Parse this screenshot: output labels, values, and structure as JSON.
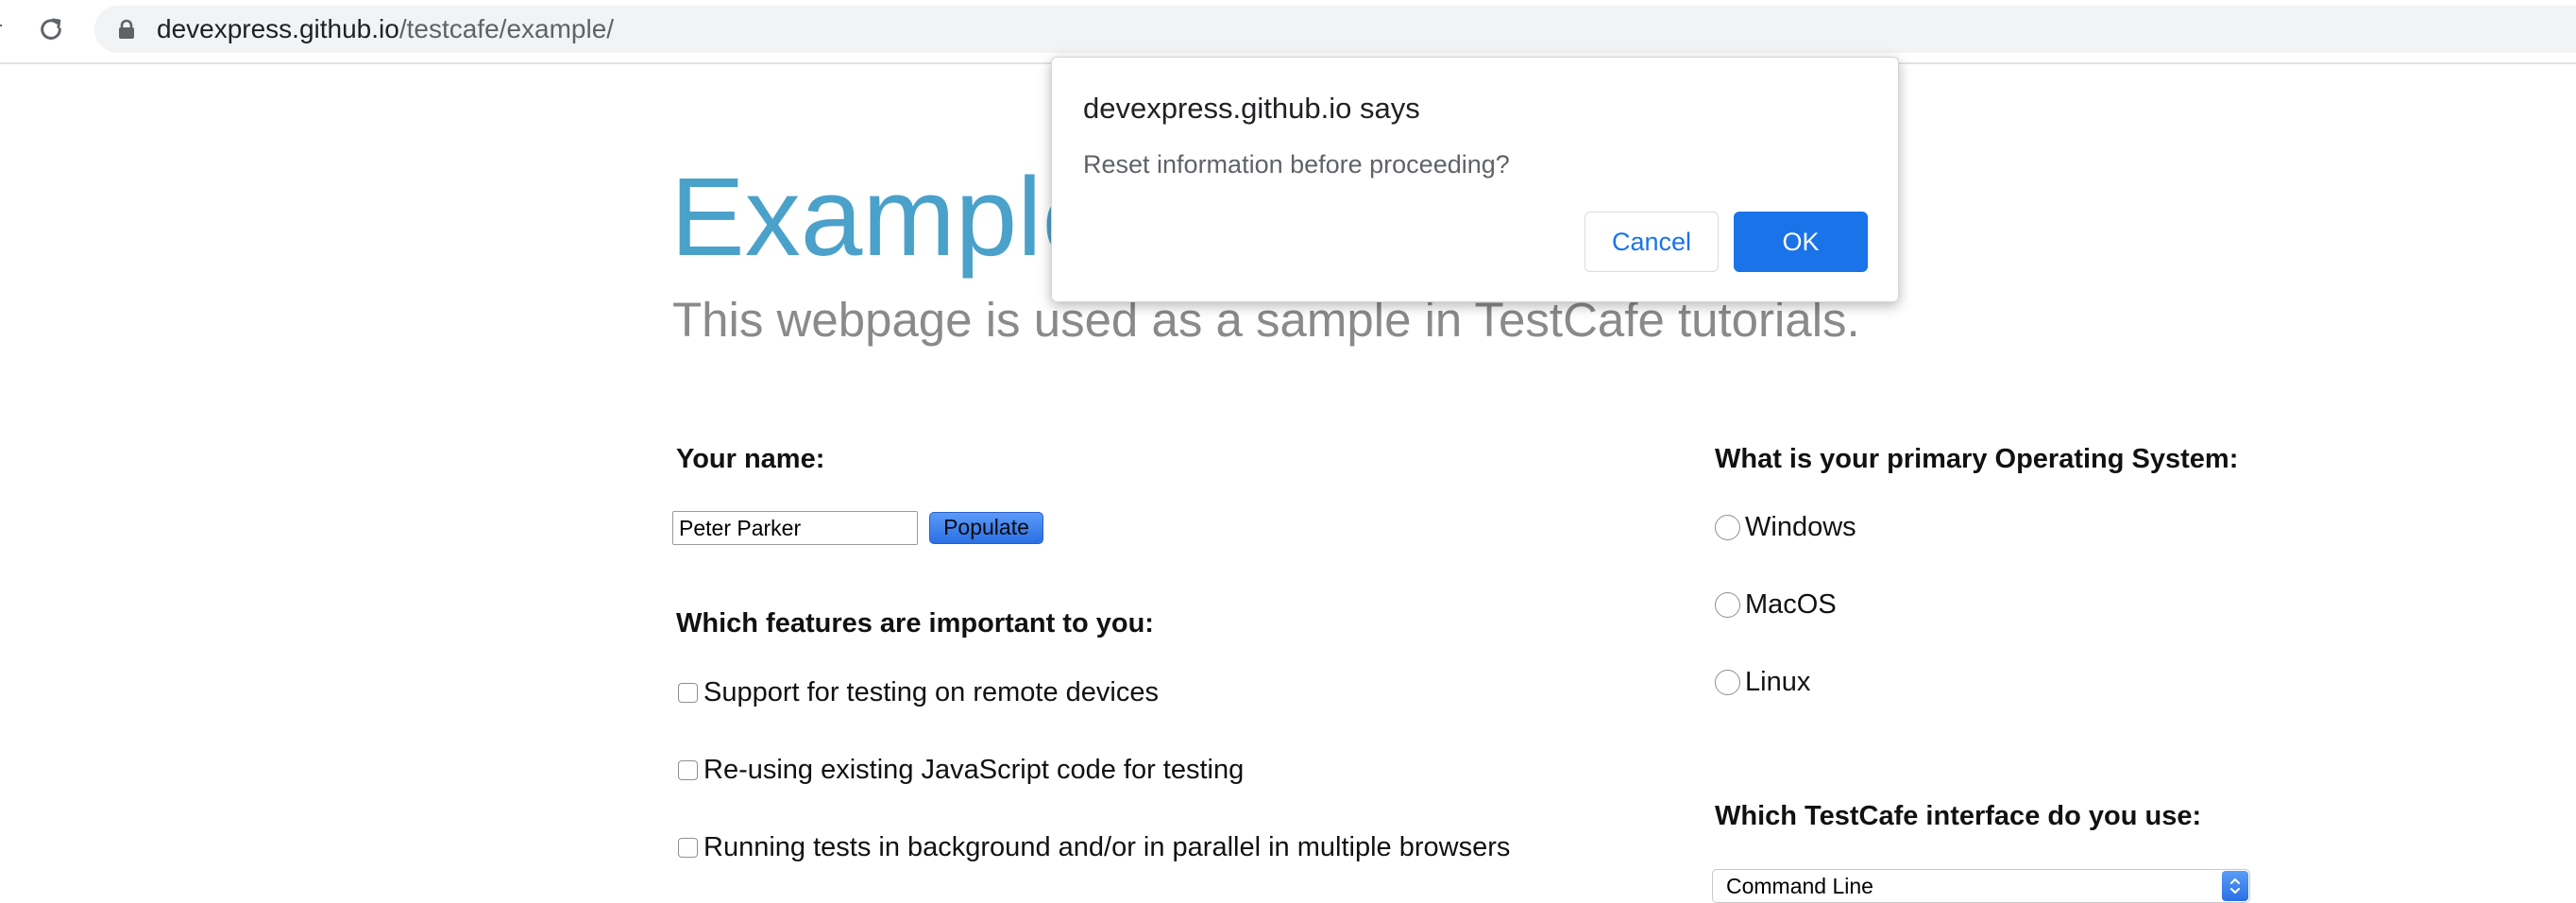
{
  "browser": {
    "url_host": "devexpress.github.io",
    "url_path": "/testcafe/example/"
  },
  "page": {
    "title": "Example",
    "subtitle": "This webpage is used as a sample in TestCafe tutorials.",
    "name_section": {
      "label": "Your name:",
      "input_value": "Peter Parker",
      "populate_label": "Populate"
    },
    "features_section": {
      "label": "Which features are important to you:",
      "options": [
        "Support for testing on remote devices",
        "Re-using existing JavaScript code for testing",
        "Running tests in background and/or in parallel in multiple browsers"
      ]
    },
    "os_section": {
      "label": "What is your primary Operating System:",
      "options": [
        "Windows",
        "MacOS",
        "Linux"
      ]
    },
    "interface_section": {
      "label": "Which TestCafe interface do you use:",
      "selected": "Command Line"
    }
  },
  "dialog": {
    "title": "devexpress.github.io says",
    "message": "Reset information before proceeding?",
    "cancel_label": "Cancel",
    "ok_label": "OK"
  },
  "colors": {
    "title": "#4aa1c9",
    "subtitle": "#8a8a8a",
    "dialog_primary": "#1a73e8",
    "populate_button": "#2a6fe4"
  }
}
